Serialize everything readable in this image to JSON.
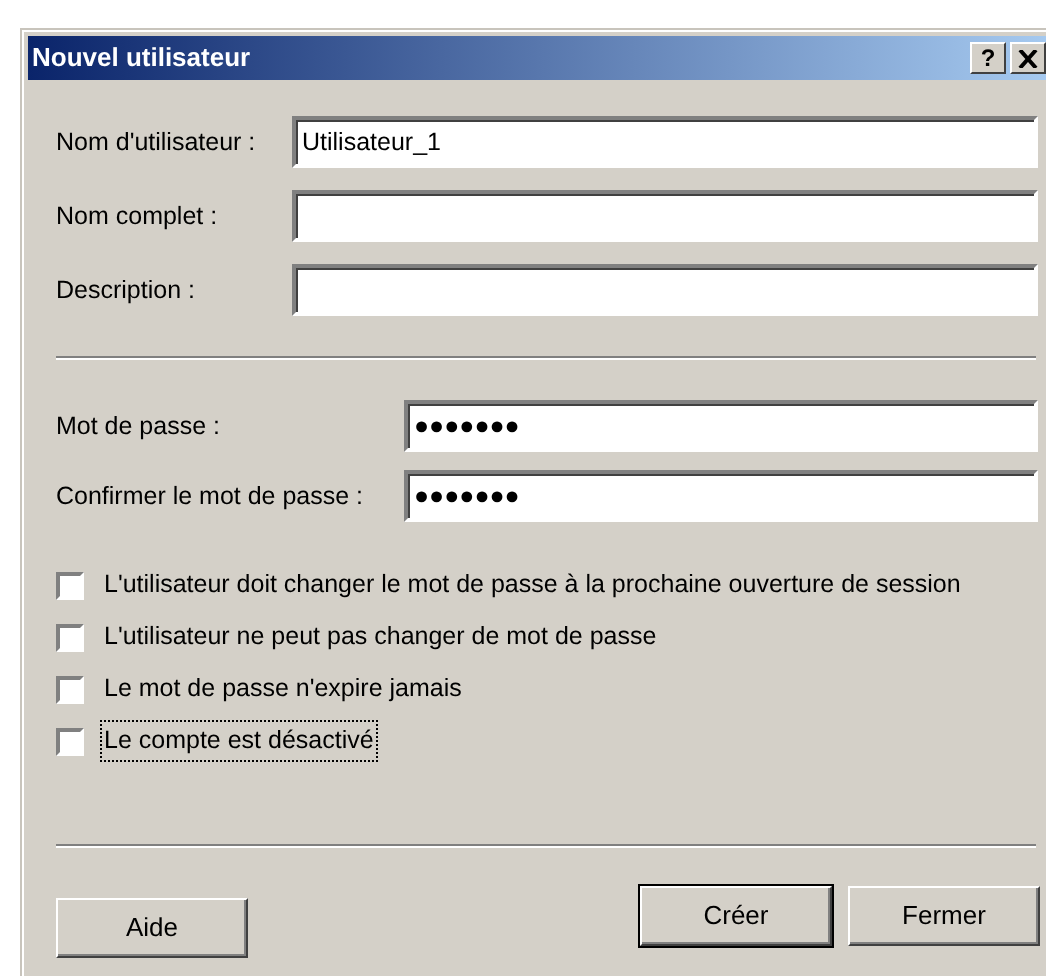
{
  "window": {
    "title": "Nouvel utilisateur",
    "title_buttons": [
      "?"
    ]
  },
  "fields": [
    {
      "label": "Nom d'utilisateur :",
      "value": "Utilisateur_1"
    },
    {
      "label": "Nom complet :"
    },
    {
      "label": "Description :"
    }
  ],
  "password_fields": [
    {
      "label": "Mot de passe :",
      "value": "●●●●●●●"
    },
    {
      "label": "Confirmer le mot de passe :",
      "value": "●●●●●●●"
    }
  ],
  "options": [
    {
      "label": "L'utilisateur doit changer le mot de passe à la prochaine ouverture de session",
      "checked": false,
      "focused": false
    },
    {
      "label": "L'utilisateur ne peut pas changer de mot de passe",
      "checked": false,
      "focused": false
    },
    {
      "label": "Le mot de passe n'expire jamais",
      "checked": false,
      "focused": false
    },
    {
      "label": "Le compte est désactivé",
      "checked": false,
      "focused": true
    }
  ],
  "help_button": "Aide",
  "buttons": [
    {
      "label": "Créer",
      "default": true
    },
    {
      "label": "Fermer",
      "default": false
    }
  ]
}
